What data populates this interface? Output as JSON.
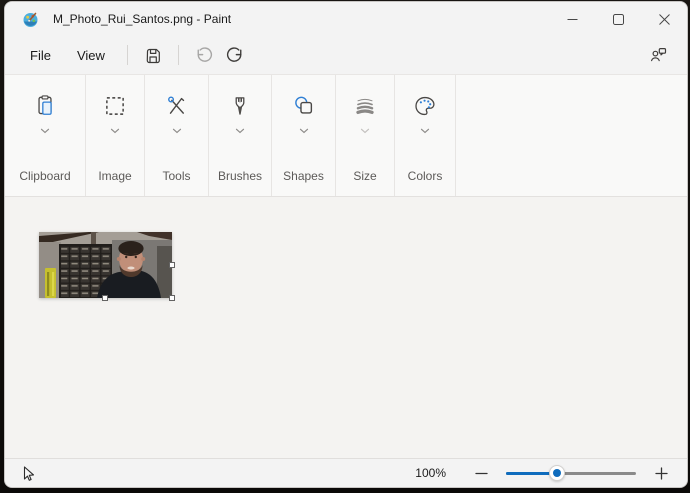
{
  "window": {
    "title": "M_Photo_Rui_Santos.png - Paint",
    "app_icon": "paint-palette-logo",
    "controls": [
      "minimize",
      "maximize",
      "close"
    ]
  },
  "menubar": {
    "file_label": "File",
    "view_label": "View",
    "icons": {
      "save": "floppy-disk",
      "undo": "undo-arrow (disabled)",
      "redo": "redo-arrow",
      "feedback": "person-with-speech-bubble"
    }
  },
  "ribbon": {
    "sections": [
      {
        "label": "Clipboard",
        "icon": "clipboard-icon"
      },
      {
        "label": "Image",
        "icon": "selection-rectangle-icon"
      },
      {
        "label": "Tools",
        "icon": "crossed-pens-icon"
      },
      {
        "label": "Brushes",
        "icon": "paintbrush-icon"
      },
      {
        "label": "Shapes",
        "icon": "circle-square-icon"
      },
      {
        "label": "Size",
        "icon": "line-weight-icon",
        "chevron_muted": true
      },
      {
        "label": "Colors",
        "icon": "palette-icon"
      }
    ]
  },
  "canvas": {
    "content": "photo-of-man-smiling-in-electronics-workshop",
    "selection_handles": [
      "right-middle",
      "bottom-middle",
      "bottom-right"
    ],
    "photo_palette": {
      "wall": "#8d8781",
      "ceiling": "#a49e96",
      "beam": "#352a22",
      "cabinet": "#211e1b",
      "drawer": "#383430",
      "yellow_object": "#c6c02e",
      "skin": "#c18f79",
      "hair": "#2a211b",
      "beard": "#50392c",
      "hoodie": "#191c21"
    }
  },
  "statusbar": {
    "tool_indicator": "pointer-cursor-icon",
    "zoom_level": "100%",
    "zoom_out": "minus",
    "zoom_in": "plus",
    "zoom_slider_percent": 39
  },
  "colors": {
    "accent": "#0f6cbd",
    "icon_blue": "#2f7fd4",
    "window_bg": "#f3f3f3",
    "ribbon_bg": "#f9f9f8",
    "canvas_bg": "#f4f3f1"
  }
}
